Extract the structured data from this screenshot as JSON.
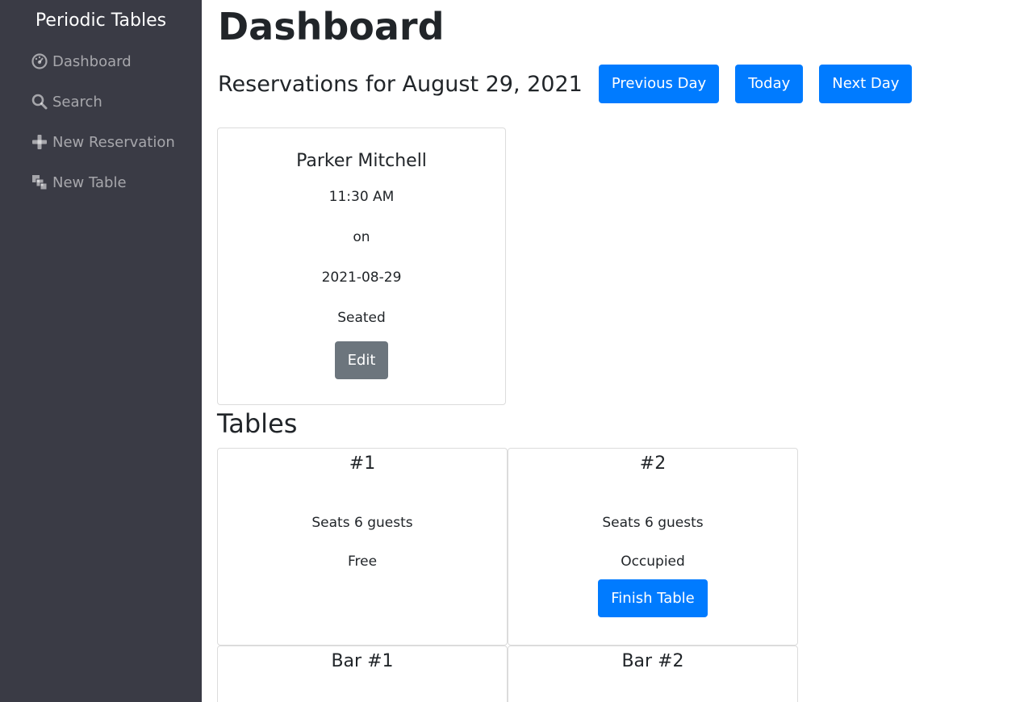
{
  "sidebar": {
    "brand": "Periodic Tables",
    "items": [
      {
        "label": "Dashboard",
        "icon": "dashboard-icon"
      },
      {
        "label": "Search",
        "icon": "search-icon"
      },
      {
        "label": "New Reservation",
        "icon": "plus-icon"
      },
      {
        "label": "New Table",
        "icon": "layers-icon"
      }
    ]
  },
  "main": {
    "title": "Dashboard",
    "date_heading": "Reservations for August 29, 2021",
    "buttons": {
      "previous": "Previous Day",
      "today": "Today",
      "next": "Next Day"
    },
    "reservations": [
      {
        "name": "Parker Mitchell",
        "time": "11:30 AM",
        "on": "on",
        "date": "2021-08-29",
        "status": "Seated",
        "edit_label": "Edit"
      }
    ],
    "tables_title": "Tables",
    "tables": [
      {
        "name": "#1",
        "seats": "Seats 6 guests",
        "status": "Free"
      },
      {
        "name": "#2",
        "seats": "Seats 6 guests",
        "status": "Occupied",
        "finish_label": "Finish Table"
      },
      {
        "name": "Bar #1"
      },
      {
        "name": "Bar #2"
      }
    ]
  },
  "colors": {
    "sidebar_bg": "#3a3b45",
    "primary": "#007bff",
    "secondary": "#6c757d"
  }
}
